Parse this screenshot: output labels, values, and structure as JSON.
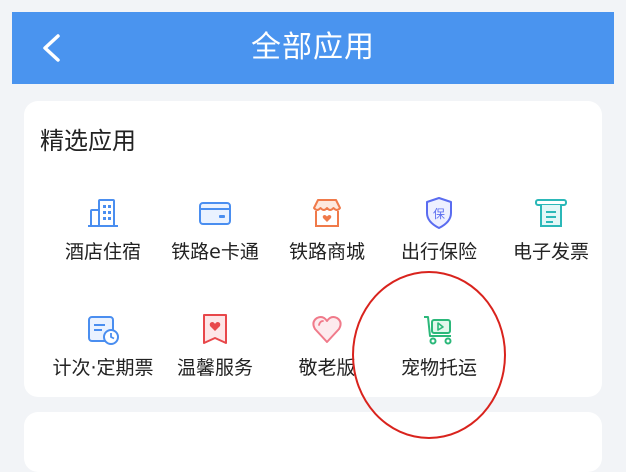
{
  "header": {
    "title": "全部应用",
    "back_icon": "chevron-left-icon",
    "background": "#4a94ef"
  },
  "section": {
    "title": "精选应用",
    "apps": [
      {
        "label": "酒店住宿",
        "icon": "hotel-building-icon",
        "color": "#4a8ef0"
      },
      {
        "label": "铁路e卡通",
        "icon": "card-icon",
        "color": "#4a8ef0"
      },
      {
        "label": "铁路商城",
        "icon": "shop-icon",
        "color": "#f07a4a"
      },
      {
        "label": "出行保险",
        "icon": "shield-icon",
        "color": "#5a6cf0"
      },
      {
        "label": "电子发票",
        "icon": "receipt-icon",
        "color": "#2bb8b8"
      },
      {
        "label": "计次·定期票",
        "icon": "ticket-clock-icon",
        "color": "#4a8ef0"
      },
      {
        "label": "温馨服务",
        "icon": "heart-bookmark-icon",
        "color": "#e8474a"
      },
      {
        "label": "敬老版",
        "icon": "heart-icon",
        "color": "#f07a8a"
      },
      {
        "label": "宠物托运",
        "icon": "pet-cart-icon",
        "color": "#2bb87a"
      }
    ]
  },
  "annotation": {
    "shape": "circle",
    "color": "#d9231d"
  }
}
